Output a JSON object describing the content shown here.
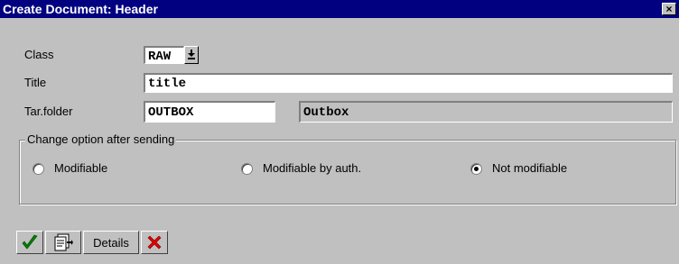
{
  "window": {
    "title": "Create Document: Header",
    "close_glyph": "×"
  },
  "form": {
    "class_label": "Class",
    "class_value": "RAW",
    "title_label": "Title",
    "title_value": "title",
    "folder_label": "Tar.folder",
    "folder_value": "OUTBOX",
    "folder_description": "Outbox"
  },
  "change_option": {
    "group_title": "Change option after sending",
    "options": [
      {
        "label": "Modifiable",
        "selected": false
      },
      {
        "label": "Modifiable by auth.",
        "selected": false
      },
      {
        "label": "Not modifiable",
        "selected": true
      }
    ]
  },
  "toolbar": {
    "details_label": "Details",
    "icons": [
      "checkmark-icon",
      "document-icon",
      "cancel-icon"
    ],
    "colors": {
      "check": "#008000",
      "cancel": "#e00000"
    }
  }
}
